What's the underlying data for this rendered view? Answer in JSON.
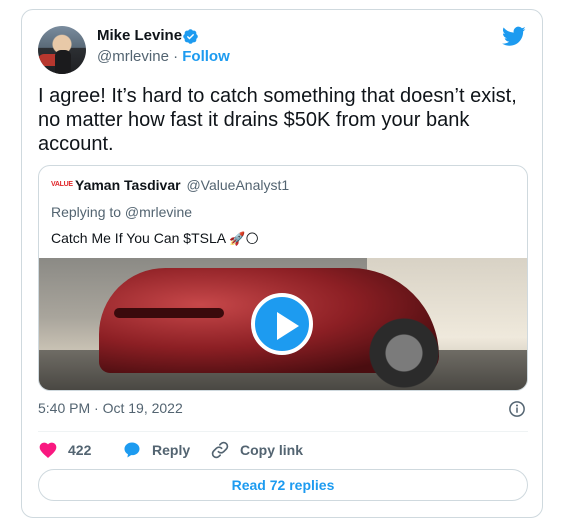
{
  "author": {
    "name": "Mike Levine",
    "handle": "@mrlevine",
    "separator": "·",
    "follow_label": "Follow",
    "verified": true
  },
  "tweet": {
    "text": "I agree! It’s hard to catch something that doesn’t exist, no matter how fast it drains $50K from your bank account.",
    "timestamp": "5:40 PM · Oct 19, 2022"
  },
  "quoted_tweet": {
    "logo_text": "VALUE",
    "name": "Yaman Tasdivar",
    "handle": "@ValueAnalyst1",
    "replying_to": "Replying to @mrlevine",
    "text": "Catch Me If You Can $TSLA",
    "emojis": "🚀🌕"
  },
  "actions": {
    "likes_count": "422",
    "reply_label": "Reply",
    "copy_link_label": "Copy link"
  },
  "read_replies_label": "Read 72 replies",
  "colors": {
    "accent": "#1d9bf0",
    "like": "#f91880",
    "muted": "#536471",
    "border": "#cfd9de"
  }
}
